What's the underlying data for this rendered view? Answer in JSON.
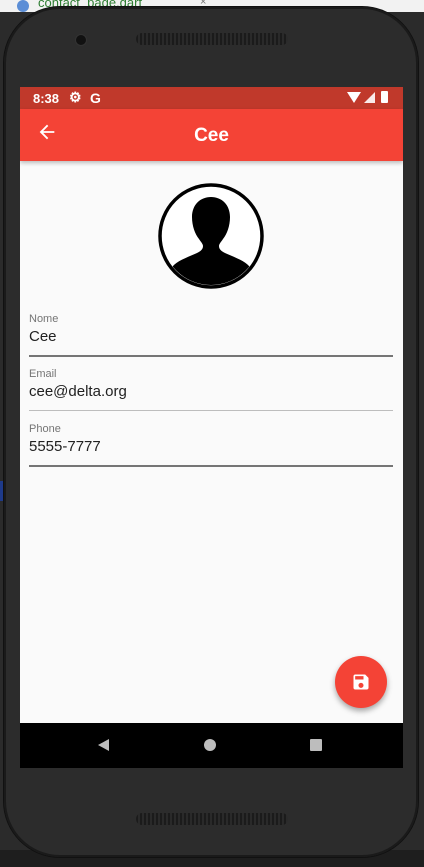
{
  "background": {
    "tab_title": "contact_page.dart",
    "tab_close": "×"
  },
  "status_bar": {
    "time": "8:38",
    "icons": [
      "gear-icon",
      "google-g-icon",
      "wifi-icon",
      "signal-icon",
      "battery-icon"
    ],
    "g_label": "G",
    "gear_glyph": "⚙",
    "color": "#c0392b"
  },
  "app_bar": {
    "title": "Cee",
    "color": "#f44336"
  },
  "form": {
    "fields": [
      {
        "label": "Nome",
        "value": "Cee"
      },
      {
        "label": "Email",
        "value": "cee@delta.org"
      },
      {
        "label": "Phone",
        "value": "5555-7777"
      }
    ]
  },
  "fab": {
    "icon": "save-icon"
  },
  "nav_bar": {
    "icons": [
      "nav-back-icon",
      "nav-home-icon",
      "nav-recents-icon"
    ]
  }
}
